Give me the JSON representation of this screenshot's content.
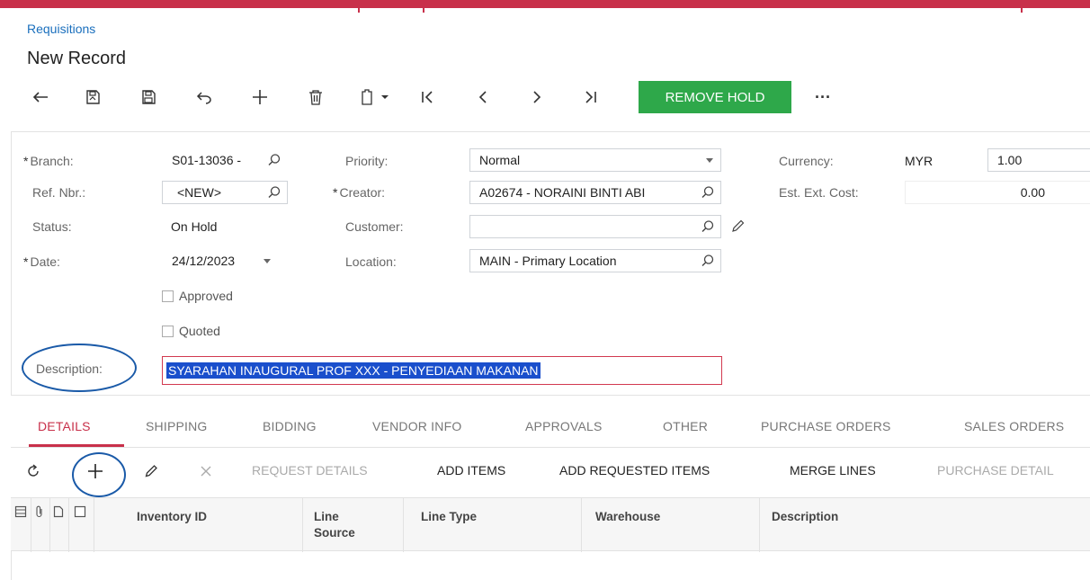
{
  "breadcrumb": "Requisitions",
  "page_title": "New Record",
  "toolbar": {
    "remove_hold": "REMOVE HOLD",
    "more": "···",
    "icons": [
      "back-arrow-icon",
      "save-close-icon",
      "save-icon",
      "undo-icon",
      "add-icon",
      "delete-icon",
      "copy-paste-icon",
      "first-record-icon",
      "previous-icon",
      "next-icon",
      "last-record-icon"
    ]
  },
  "form": {
    "branch": {
      "label": "Branch:",
      "value": "S01-13036 -"
    },
    "ref_nbr": {
      "label": "Ref. Nbr.:",
      "value": "<NEW>"
    },
    "status": {
      "label": "Status:",
      "value": "On Hold"
    },
    "date": {
      "label": "Date:",
      "value": "24/12/2023"
    },
    "approved": {
      "label": "Approved",
      "checked": false
    },
    "quoted": {
      "label": "Quoted",
      "checked": false
    },
    "priority": {
      "label": "Priority:",
      "value": "Normal"
    },
    "creator": {
      "label": "Creator:",
      "value": "A02674 - NORAINI BINTI ABI"
    },
    "customer": {
      "label": "Customer:",
      "value": ""
    },
    "location": {
      "label": "Location:",
      "value": "MAIN - Primary Location"
    },
    "currency": {
      "label": "Currency:",
      "code": "MYR",
      "rate": "1.00"
    },
    "est_ext_cost": {
      "label": "Est. Ext. Cost:",
      "value": "0.00"
    },
    "description": {
      "label": "Description:",
      "value": "SYARAHAN INAUGURAL PROF XXX - PENYEDIAAN MAKANAN"
    },
    "required_marker": "*"
  },
  "tabs": [
    "DETAILS",
    "SHIPPING",
    "BIDDING",
    "VENDOR INFO",
    "APPROVALS",
    "OTHER",
    "PURCHASE ORDERS",
    "SALES ORDERS"
  ],
  "grid_toolbar": {
    "request_details": "REQUEST DETAILS",
    "add_items": "ADD ITEMS",
    "add_requested_items": "ADD REQUESTED ITEMS",
    "merge_lines": "MERGE LINES",
    "purchase_details": "PURCHASE DETAIL"
  },
  "grid_columns": {
    "inventory_id": "Inventory ID",
    "line_source_1": "Line",
    "line_source_2": "Source",
    "line_type": "Line Type",
    "warehouse": "Warehouse",
    "description": "Description"
  },
  "colors": {
    "accent": "#c8304a",
    "remove_hold_bg": "#2ea84a",
    "link": "#1a6fbd",
    "annotation_circle": "#1a5aa8",
    "selection": "#1a4fcc"
  }
}
